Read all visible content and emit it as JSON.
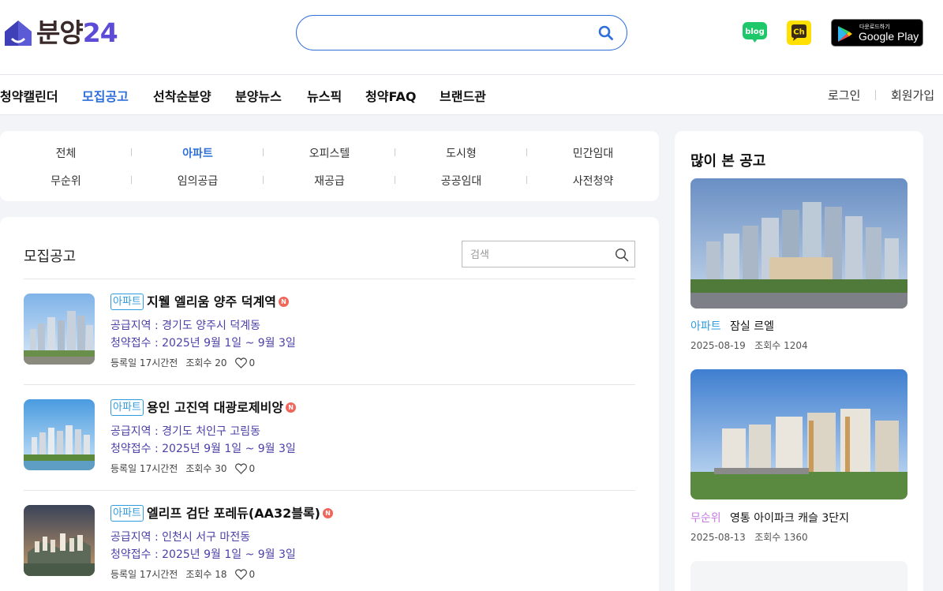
{
  "header": {
    "logo_text": "분양",
    "logo_num": "24",
    "search_placeholder": "",
    "blog_label": "blog",
    "channel_label": "Ch",
    "gplay_small": "다운로드하기",
    "gplay_big": "Google Play"
  },
  "nav": {
    "items": [
      "청약캘린더",
      "모집공고",
      "선착순분양",
      "분양뉴스",
      "뉴스픽",
      "청약FAQ",
      "브랜드관"
    ],
    "active": "모집공고",
    "login": "로그인",
    "signup": "회원가입"
  },
  "categories": {
    "row1": [
      "전체",
      "아파트",
      "오피스텔",
      "도시형",
      "민간임대"
    ],
    "row2": [
      "무순위",
      "임의공급",
      "재공급",
      "공공임대",
      "사전청약"
    ],
    "active": "아파트"
  },
  "list": {
    "title": "모집공고",
    "search_placeholder": "검색",
    "items": [
      {
        "tag": "아파트",
        "title": "지웰 엘리움 양주 덕계역",
        "badge": "N",
        "region": "공급지역 : 경기도 양주시 덕계동",
        "period": "청약접수 : 2025년 9월 1일 ~ 9월 3일",
        "registered": "등록일 17시간전",
        "views": "조회수 20",
        "likes": "0"
      },
      {
        "tag": "아파트",
        "title": "용인 고진역 대광로제비앙",
        "badge": "N",
        "region": "공급지역 : 경기도 처인구 고림동",
        "period": "청약접수 : 2025년 9월 1일 ~ 9월 3일",
        "registered": "등록일 17시간전",
        "views": "조회수 30",
        "likes": "0"
      },
      {
        "tag": "아파트",
        "title": "엘리프 검단 포레듀(AA32블록)",
        "badge": "N",
        "region": "공급지역 : 인천시 서구 마전동",
        "period": "청약접수 : 2025년 9월 1일 ~ 9월 3일",
        "registered": "등록일 17시간전",
        "views": "조회수 18",
        "likes": "0"
      }
    ]
  },
  "sidebar": {
    "title": "많이 본 공고",
    "items": [
      {
        "tag": "아파트",
        "tag_color": "#2f9be0",
        "name": "잠실 르엘",
        "date": "2025-08-19",
        "views": "조회수 1204"
      },
      {
        "tag": "무순위",
        "tag_color": "#c77be0",
        "name": "영통 아이파크 캐슬 3단지",
        "date": "2025-08-13",
        "views": "조회수 1360"
      }
    ]
  },
  "colors": {
    "accent": "#2f6fd8",
    "tag_blue": "#2f9be0",
    "meta_purple": "#4b3fa8",
    "badge_red": "#f0665a"
  }
}
